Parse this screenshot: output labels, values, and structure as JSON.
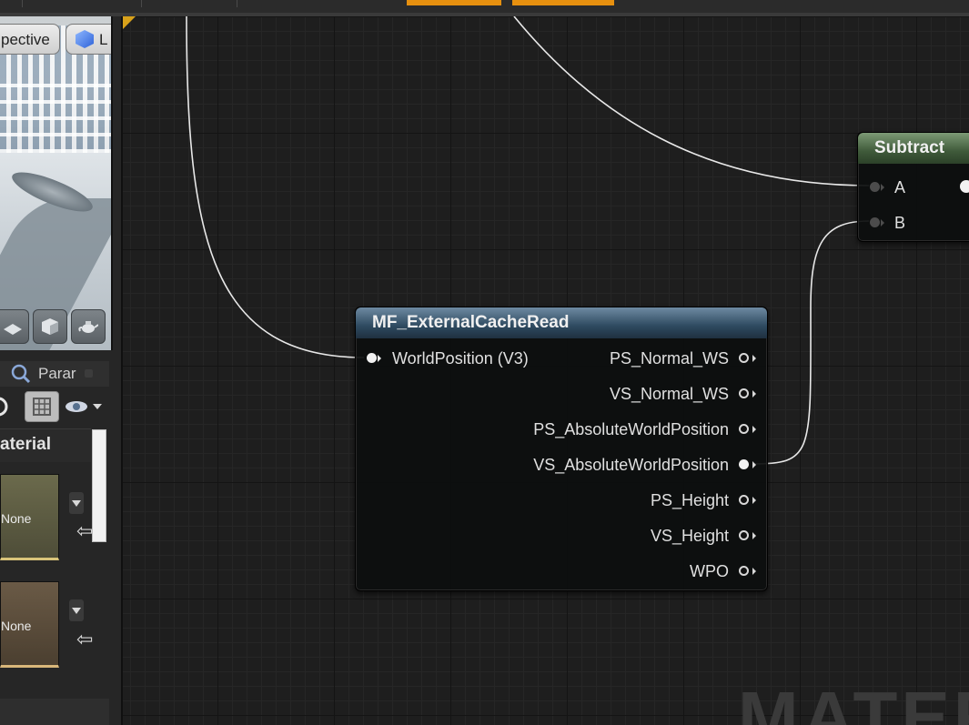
{
  "viewport": {
    "perspective_label": "pective",
    "lit_label": "L"
  },
  "panel_tab": {
    "label": "Parar"
  },
  "details": {
    "section_title": "aterial",
    "thumb1_label": "None",
    "thumb2_label": "None"
  },
  "graph": {
    "watermark": "MATER",
    "mf_node": {
      "title": "MF_ExternalCacheRead",
      "input_pin": "WorldPosition (V3)",
      "output_pins": [
        "PS_Normal_WS",
        "VS_Normal_WS",
        "PS_AbsoluteWorldPosition",
        "VS_AbsoluteWorldPosition",
        "PS_Height",
        "VS_Height",
        "WPO"
      ]
    },
    "subtract_node": {
      "title": "Subtract",
      "pin_a": "A",
      "pin_b": "B"
    }
  },
  "colors": {
    "accent_orange": "#e7900f",
    "mf_header": "#2e4a60",
    "subtract_header": "#3f5a3a"
  }
}
